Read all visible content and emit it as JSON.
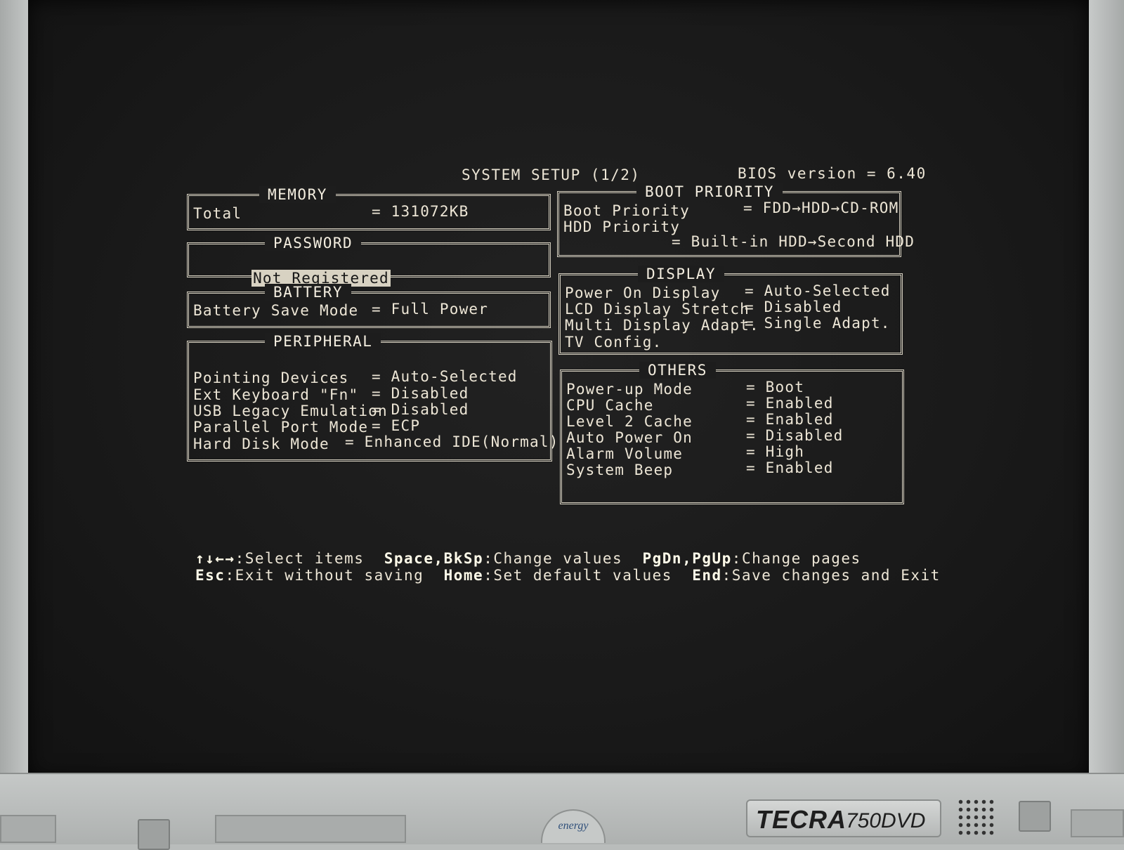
{
  "header": {
    "title": "SYSTEM SETUP (1/2)",
    "bios_version": "BIOS version = 6.40"
  },
  "memory": {
    "title": "MEMORY",
    "label": "Total",
    "value": "= 131072KB"
  },
  "password": {
    "title": "PASSWORD",
    "value": "Not Registered"
  },
  "battery": {
    "title": "BATTERY",
    "label": "Battery Save Mode",
    "value": "= Full Power"
  },
  "peripheral": {
    "title": "PERIPHERAL",
    "items": [
      {
        "label": "Pointing Devices",
        "value": "= Auto-Selected"
      },
      {
        "label": "Ext Keyboard \"Fn\"",
        "value": "= Disabled"
      },
      {
        "label": "USB Legacy Emulation",
        "value": "= Disabled"
      },
      {
        "label": "Parallel Port Mode",
        "value": "= ECP"
      },
      {
        "label": "Hard Disk Mode",
        "value": "= Enhanced IDE(Normal)"
      }
    ]
  },
  "boot_priority": {
    "title": "BOOT PRIORITY",
    "items": [
      {
        "label": "Boot Priority",
        "value": "= FDD→HDD→CD-ROM"
      },
      {
        "label": "HDD Priority",
        "value": "= Built-in HDD→Second HDD"
      }
    ]
  },
  "display": {
    "title": "DISPLAY",
    "items": [
      {
        "label": "Power On Display",
        "value": "= Auto-Selected"
      },
      {
        "label": "LCD Display Stretch",
        "value": "= Disabled"
      },
      {
        "label": "Multi Display Adapt.",
        "value": "= Single Adapt."
      },
      {
        "label": "TV Config.",
        "value": ""
      }
    ]
  },
  "others": {
    "title": "OTHERS",
    "items": [
      {
        "label": "Power-up Mode",
        "value": "= Boot"
      },
      {
        "label": "CPU Cache",
        "value": "= Enabled"
      },
      {
        "label": "Level 2 Cache",
        "value": "= Enabled"
      },
      {
        "label": "Auto Power On",
        "value": "= Disabled"
      },
      {
        "label": "Alarm Volume",
        "value": "= High"
      },
      {
        "label": "System Beep",
        "value": "= Enabled"
      }
    ]
  },
  "help": {
    "line1": [
      {
        "key": "↑↓←→",
        "action": ":Select items"
      },
      {
        "key": "Space,BkSp",
        "action": ":Change values"
      },
      {
        "key": "PgDn,PgUp",
        "action": ":Change pages"
      }
    ],
    "line2": [
      {
        "key": "Esc",
        "action": ":Exit without saving"
      },
      {
        "key": "Home",
        "action": ":Set default values"
      },
      {
        "key": "End",
        "action": ":Save changes and Exit"
      }
    ]
  },
  "hardware": {
    "brand": "TECRA",
    "model": "750DVD",
    "energy_logo": "energy"
  }
}
